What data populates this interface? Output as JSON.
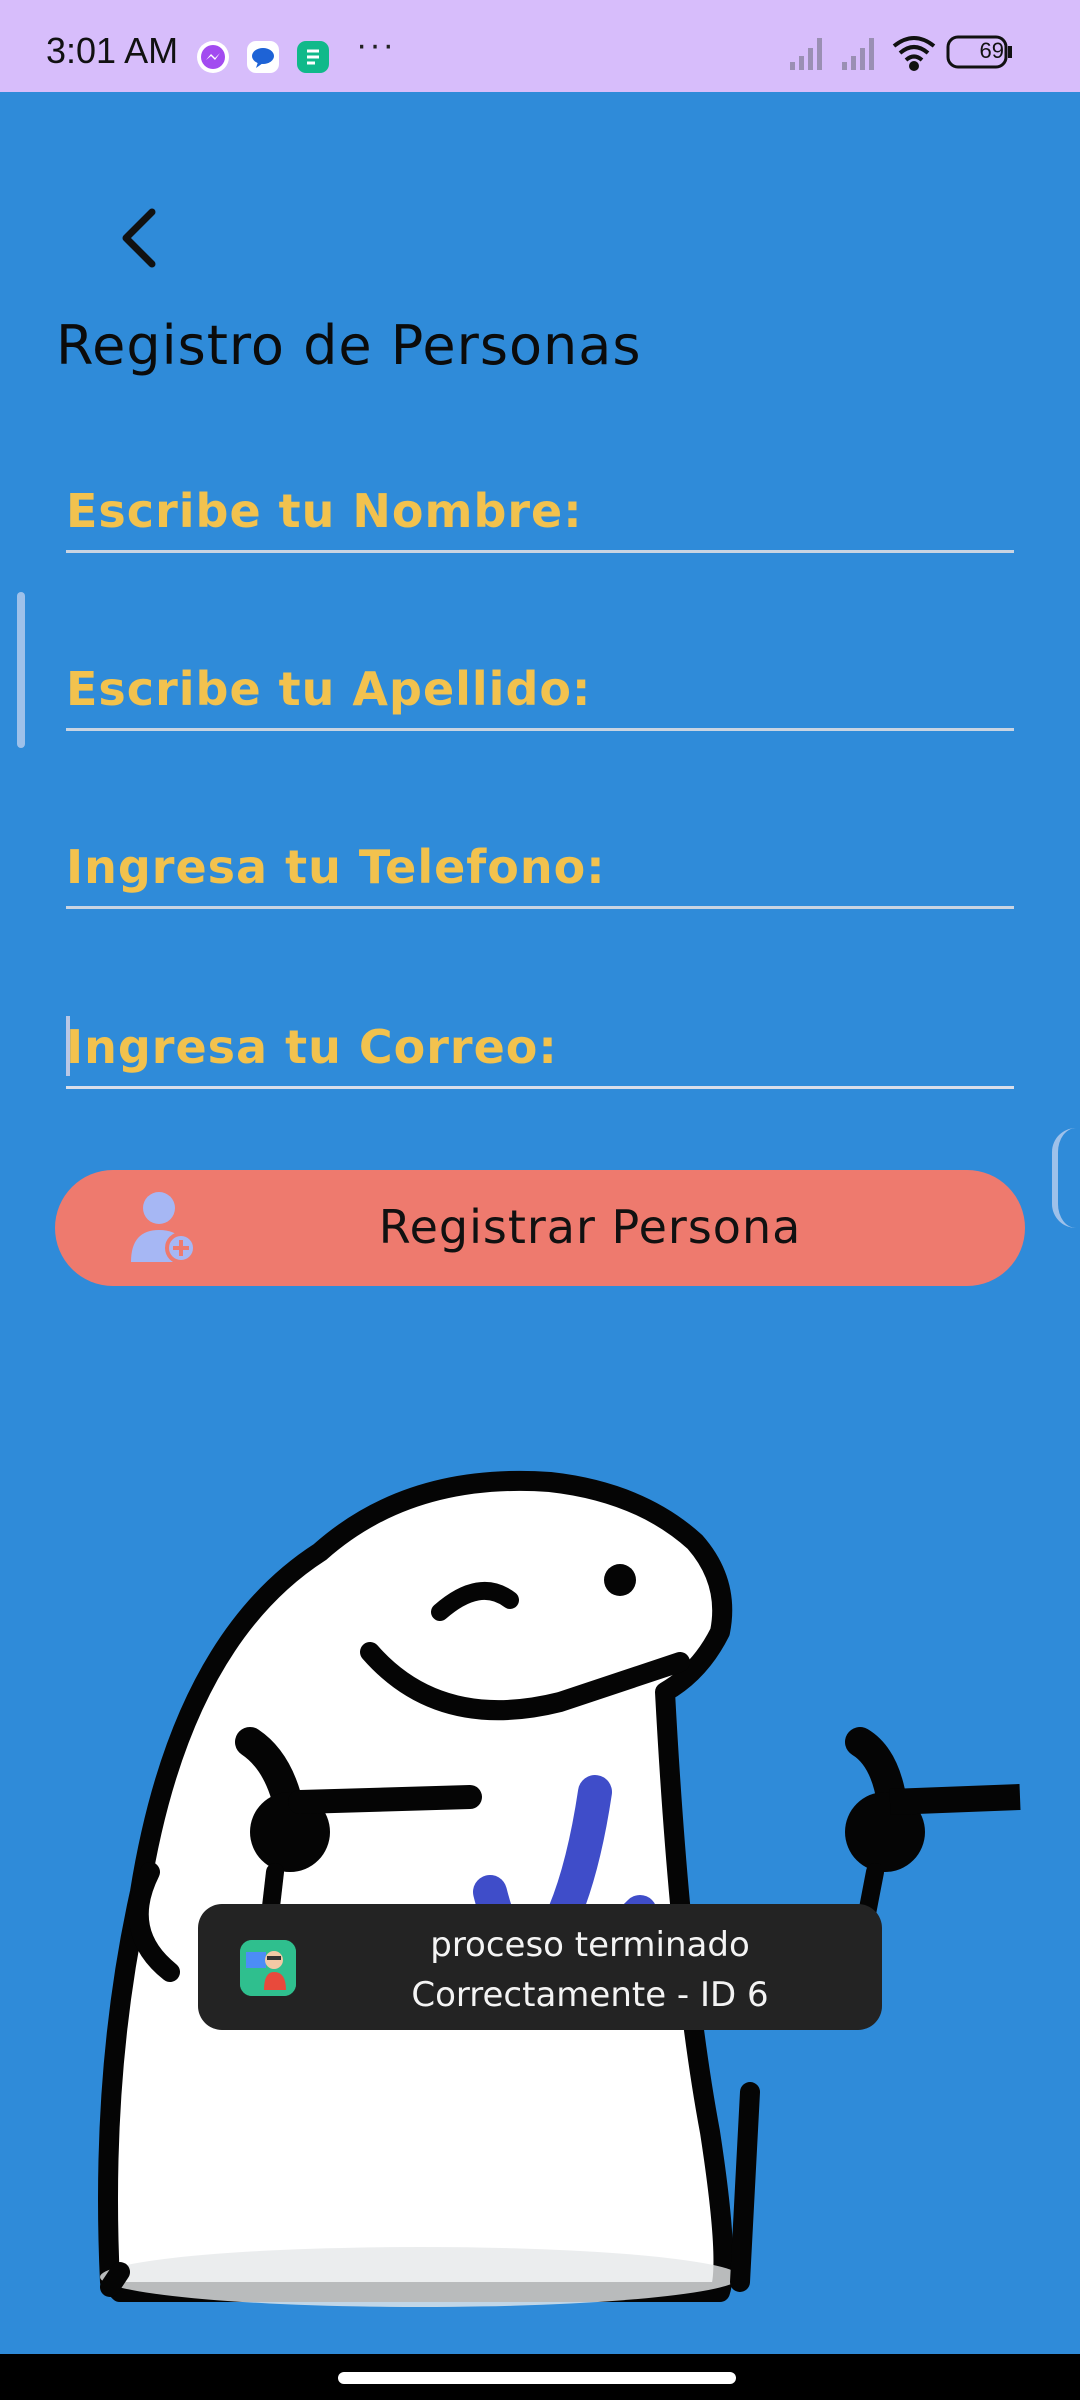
{
  "status_bar": {
    "time": "3:01  AM",
    "overflow": "···",
    "battery": "69",
    "icons": [
      "messenger-icon",
      "messages-icon",
      "app-notification-icon",
      "signal-icon",
      "signal-icon",
      "wifi-icon",
      "battery-icon"
    ]
  },
  "page": {
    "title": "Registro de Personas"
  },
  "form": {
    "nombre_placeholder": "Escribe tu Nombre:",
    "apellido_placeholder": "Escribe tu Apellido:",
    "telefono_placeholder": "Ingresa tu Telefono:",
    "correo_placeholder": "Ingresa tu Correo:"
  },
  "register_button": {
    "label": "Registrar Persona",
    "icon": "add-person-icon"
  },
  "toast": {
    "line1": "proceso terminado",
    "line2": "Correctamente - ID 6"
  },
  "colors": {
    "background": "#2F8BD9",
    "status_bar": "#D7BDFB",
    "placeholder": "#F2C24E",
    "button": "#EE7A6E",
    "toast": "#232323"
  }
}
